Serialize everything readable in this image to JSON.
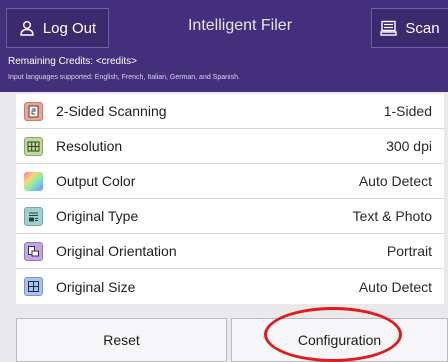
{
  "header": {
    "logout_label": "Log Out",
    "title": "Intelligent Filer",
    "scan_label": "Scan",
    "credits_text": "Remaining Credits: <credits>",
    "languages_text": "Input languages supported: English, French, Italian, German, and Spanish."
  },
  "settings": [
    {
      "label": "2-Sided Scanning",
      "value": "1-Sided",
      "icon": "two-sided-icon",
      "icon_color": "#e8a597"
    },
    {
      "label": "Resolution",
      "value": "300 dpi",
      "icon": "resolution-grid-icon",
      "icon_color": "#bcd89a"
    },
    {
      "label": "Output Color",
      "value": "Auto Detect",
      "icon": "color-spectrum-icon",
      "icon_color": "#f2a0c8"
    },
    {
      "label": "Original Type",
      "value": "Text & Photo",
      "icon": "document-type-icon",
      "icon_color": "#9fd1cf"
    },
    {
      "label": "Original Orientation",
      "value": "Portrait",
      "icon": "orientation-icon",
      "icon_color": "#c2a6e4"
    },
    {
      "label": "Original Size",
      "value": "Auto Detect",
      "icon": "paper-size-icon",
      "icon_color": "#a9c3ec"
    }
  ],
  "footer": {
    "reset_label": "Reset",
    "configuration_label": "Configuration"
  },
  "colors": {
    "header_bg": "#43307c",
    "annotation": "#e01b1b"
  }
}
